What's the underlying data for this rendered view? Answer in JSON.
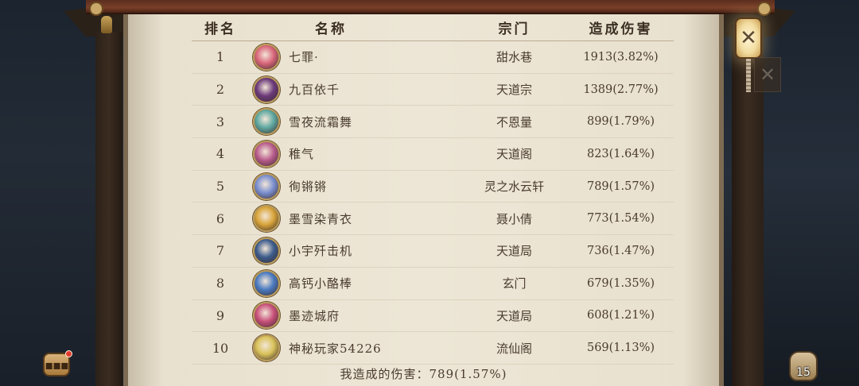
{
  "header": {
    "rank": "排名",
    "name": "名称",
    "sect": "宗门",
    "damage": "造成伤害"
  },
  "rows": [
    {
      "rank": "1",
      "name": "七罪·",
      "sect": "甜水巷",
      "damage": "1913(3.82%)",
      "avatar_color": "#d9667a"
    },
    {
      "rank": "2",
      "name": "九百依千",
      "sect": "天道宗",
      "damage": "1389(2.77%)",
      "avatar_color": "#6b3a7a"
    },
    {
      "rank": "3",
      "name": "雪夜流霜舞",
      "sect": "不恩量",
      "damage": "899(1.79%)",
      "avatar_color": "#5ea8a0"
    },
    {
      "rank": "4",
      "name": "稚气",
      "sect": "天道阁",
      "damage": "823(1.64%)",
      "avatar_color": "#b85c8c"
    },
    {
      "rank": "5",
      "name": "徇锵锵",
      "sect": "灵之水云轩",
      "damage": "789(1.57%)",
      "avatar_color": "#7a8fd0"
    },
    {
      "rank": "6",
      "name": "墨雪染青衣",
      "sect": "聂小倩",
      "damage": "773(1.54%)",
      "avatar_color": "#d9a53a"
    },
    {
      "rank": "7",
      "name": "小宇歼击机",
      "sect": "天道局",
      "damage": "736(1.47%)",
      "avatar_color": "#3d5c8c"
    },
    {
      "rank": "8",
      "name": "高钙小酪棒",
      "sect": "玄门",
      "damage": "679(1.35%)",
      "avatar_color": "#4a7ac0"
    },
    {
      "rank": "9",
      "name": "墨迹城府",
      "sect": "天道局",
      "damage": "608(1.21%)",
      "avatar_color": "#c8507a"
    },
    {
      "rank": "10",
      "name": "神秘玩家54226",
      "sect": "流仙阁",
      "damage": "569(1.13%)",
      "avatar_color": "#d9c25a"
    }
  ],
  "footer": {
    "my_damage": "我造成的伤害：789(1.57%)"
  },
  "bag_count": "15"
}
